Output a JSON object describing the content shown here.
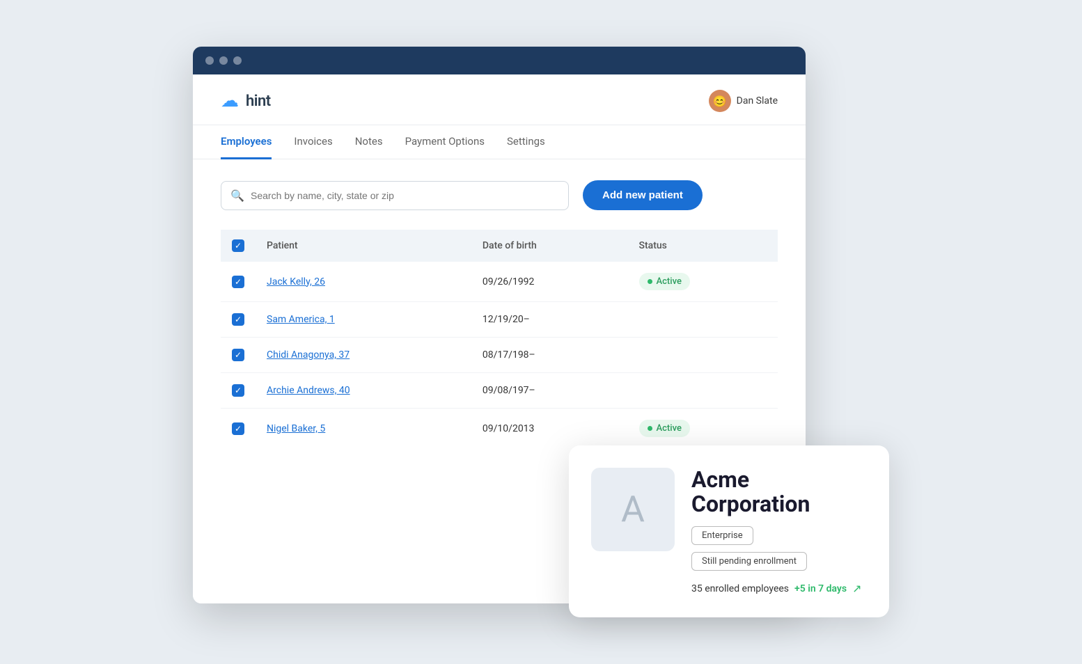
{
  "app": {
    "logo_text": "hint",
    "user_name": "Dan Slate",
    "user_emoji": "😊"
  },
  "nav": {
    "tabs": [
      {
        "id": "employees",
        "label": "Employees",
        "active": true
      },
      {
        "id": "invoices",
        "label": "Invoices",
        "active": false
      },
      {
        "id": "notes",
        "label": "Notes",
        "active": false
      },
      {
        "id": "payment-options",
        "label": "Payment Options",
        "active": false
      },
      {
        "id": "settings",
        "label": "Settings",
        "active": false
      }
    ]
  },
  "search": {
    "placeholder": "Search by name, city, state or zip"
  },
  "add_patient_button": "Add new patient",
  "table": {
    "headers": [
      "Patient",
      "Date of birth",
      "Status"
    ],
    "rows": [
      {
        "name": "Jack Kelly, 26",
        "dob": "09/26/1992",
        "status": "Active"
      },
      {
        "name": "Sam America, 1",
        "dob": "12/19/20–",
        "status": ""
      },
      {
        "name": "Chidi Anagonya, 37",
        "dob": "08/17/198–",
        "status": ""
      },
      {
        "name": "Archie Andrews, 40",
        "dob": "09/08/197–",
        "status": ""
      },
      {
        "name": "Nigel Baker, 5",
        "dob": "09/10/2013",
        "status": "Active"
      }
    ]
  },
  "company_card": {
    "initial": "A",
    "name": "Acme Corporation",
    "tags": [
      "Enterprise",
      "Still pending enrollment"
    ],
    "enrolled_count": "35 enrolled employees",
    "growth": "+5 in 7 days"
  }
}
